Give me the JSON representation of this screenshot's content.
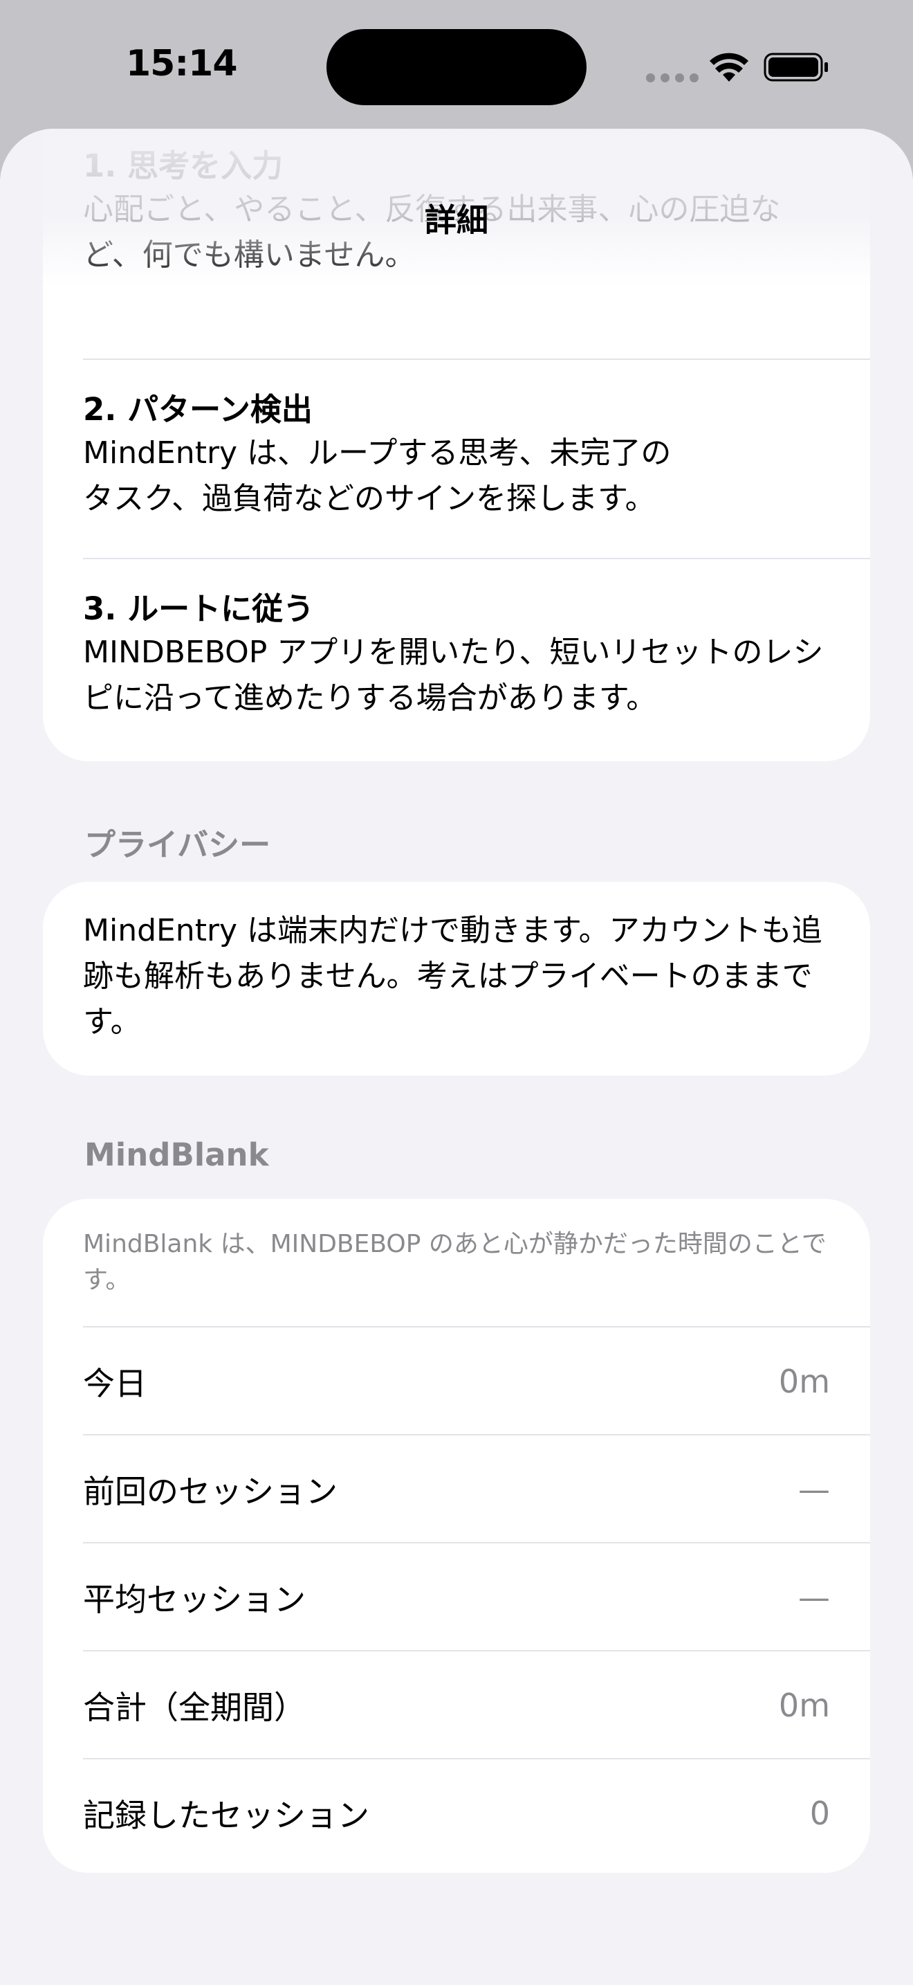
{
  "status_bar": {
    "time": "15:14"
  },
  "sheet": {
    "title": "詳細"
  },
  "steps": [
    {
      "title": "1. 思考を入力",
      "body": "心配ごと、やること、反復する出来事、心の圧迫など、何でも構いません。"
    },
    {
      "title": "2. パターン検出",
      "body": "MindEntry は、ループする思考、未完了の\nタスク、過負荷などのサインを探します。"
    },
    {
      "title": "3. ルートに従う",
      "body": "MINDBEBOP アプリを開いたり、短いリセットのレシピに沿って進めたりする場合があります。"
    }
  ],
  "privacy": {
    "header": "プライバシー",
    "text": "MindEntry は端末内だけで動きます。アカウントも追跡も解析もありません。考えはプライベートのままです。"
  },
  "mindblank": {
    "header": "MindBlank",
    "description": "MindBlank は、MINDBEBOP のあと心が静かだった時間のことです。",
    "stats": [
      {
        "label": "今日",
        "value": "0m"
      },
      {
        "label": "前回のセッション",
        "value": "—"
      },
      {
        "label": "平均セッション",
        "value": "—"
      },
      {
        "label": "合計（全期間）",
        "value": "0m"
      },
      {
        "label": "記録したセッション",
        "value": "0"
      }
    ]
  }
}
